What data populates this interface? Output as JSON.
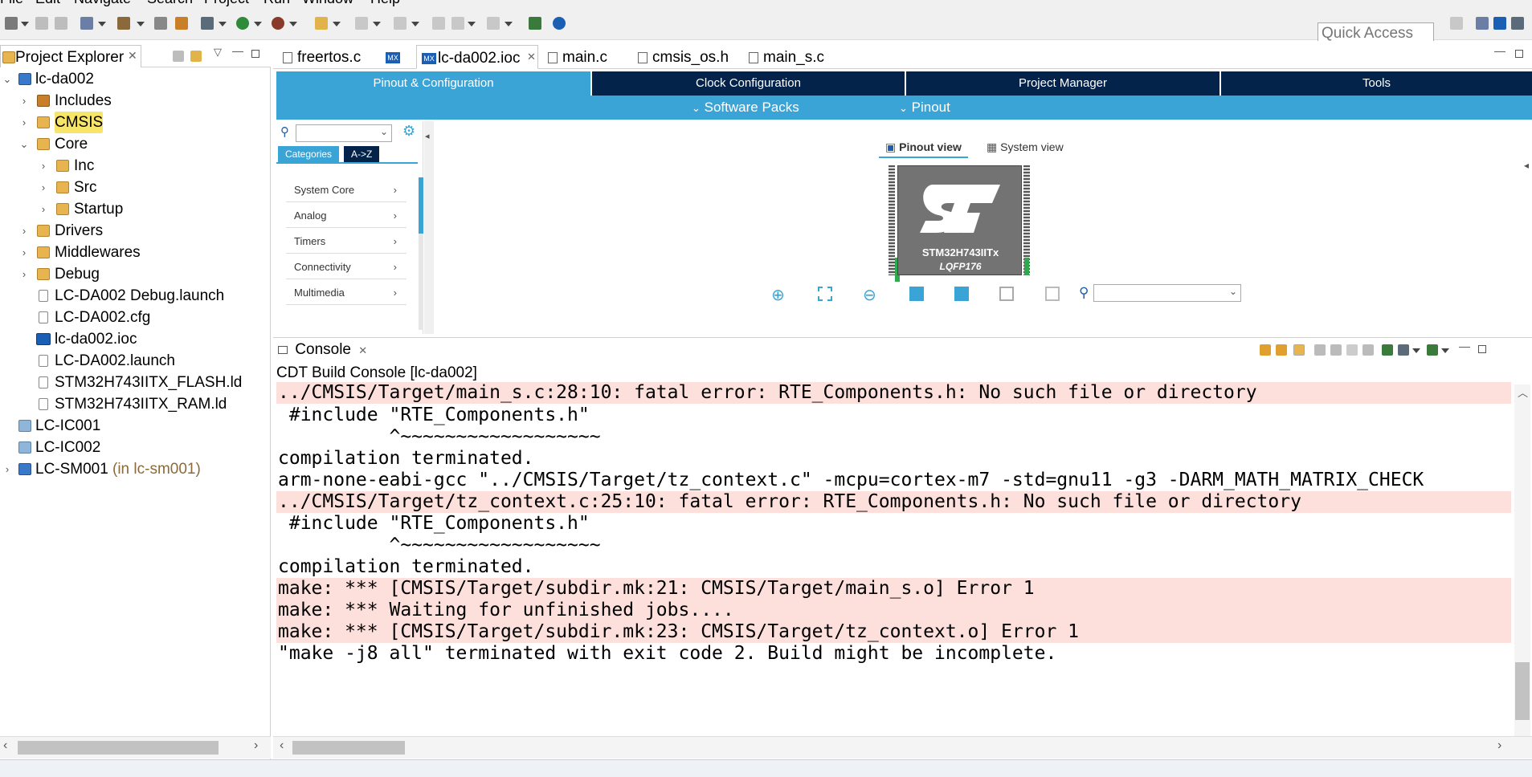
{
  "menu": [
    "File",
    "Edit",
    "Navigate",
    "Search",
    "Project",
    "Run",
    "Window",
    "Help"
  ],
  "toolbar": {
    "quick_access_placeholder": "Quick Access"
  },
  "explorer": {
    "tab_label": "Project Explorer",
    "tree": [
      {
        "label": "lc-da002",
        "arrow": "⌄",
        "icon": "project-icon"
      },
      {
        "label": "Includes",
        "arrow": "›",
        "icon": "includes-icon"
      },
      {
        "label": "CMSIS",
        "arrow": "›",
        "icon": "source-folder-icon"
      },
      {
        "label": "Core",
        "arrow": "⌄",
        "icon": "source-folder-icon"
      },
      {
        "label": "Inc",
        "arrow": "›",
        "icon": "folder-icon"
      },
      {
        "label": "Src",
        "arrow": "›",
        "icon": "folder-icon"
      },
      {
        "label": "Startup",
        "arrow": "›",
        "icon": "folder-icon"
      },
      {
        "label": "Drivers",
        "arrow": "›",
        "icon": "source-folder-icon"
      },
      {
        "label": "Middlewares",
        "arrow": "›",
        "icon": "source-folder-icon"
      },
      {
        "label": "Debug",
        "arrow": "›",
        "icon": "folder-icon"
      },
      {
        "label": "LC-DA002 Debug.launch",
        "arrow": "",
        "icon": "file-icon"
      },
      {
        "label": "LC-DA002.cfg",
        "arrow": "",
        "icon": "file-icon"
      },
      {
        "label": "lc-da002.ioc",
        "arrow": "",
        "icon": "mx-icon"
      },
      {
        "label": "LC-DA002.launch",
        "arrow": "",
        "icon": "file-icon"
      },
      {
        "label": "STM32H743IITX_FLASH.ld",
        "arrow": "",
        "icon": "file-icon"
      },
      {
        "label": "STM32H743IITX_RAM.ld",
        "arrow": "",
        "icon": "file-icon"
      },
      {
        "label": "LC-IC001",
        "arrow": "",
        "icon": "closed-project-icon"
      },
      {
        "label": "LC-IC002",
        "arrow": "",
        "icon": "closed-project-icon"
      },
      {
        "label": "LC-SM001",
        "arrow": "›",
        "icon": "project-icon",
        "suffix": "(in lc-sm001)"
      }
    ]
  },
  "editor": {
    "tabs": [
      {
        "label": "freertos.c",
        "icon": "c-file-icon"
      },
      {
        "label": "",
        "icon": "mx-icon"
      },
      {
        "label": "lc-da002.ioc",
        "icon": "mx-icon",
        "active": true
      },
      {
        "label": "main.c",
        "icon": "c-file-icon"
      },
      {
        "label": "cmsis_os.h",
        "icon": "h-file-icon"
      },
      {
        "label": "main_s.c",
        "icon": "c-file-icon"
      }
    ],
    "mx_tabs": [
      "Pinout & Configuration",
      "Clock Configuration",
      "Project Manager",
      "Tools"
    ],
    "mx_sub": {
      "software_packs": "Software Packs",
      "pinout": "Pinout"
    },
    "category_tabs": {
      "categories": "Categories",
      "az": "A->Z"
    },
    "categories": [
      "System Core",
      "Analog",
      "Timers",
      "Connectivity",
      "Multimedia"
    ],
    "views": {
      "pinout": "Pinout view",
      "system": "System view"
    },
    "chip": {
      "name": "STM32H743IITx",
      "package": "LQFP176"
    }
  },
  "console": {
    "tab_label": "Console",
    "subtitle": "CDT Build Console [lc-da002]",
    "lines": [
      {
        "text": "../CMSIS/Target/main_s.c:28:10: fatal error: RTE_Components.h: No such file or directory",
        "error": true
      },
      {
        "text": " #include \"RTE_Components.h\"",
        "error": false
      },
      {
        "text": "          ^~~~~~~~~~~~~~~~~~~",
        "error": false
      },
      {
        "text": "compilation terminated.",
        "error": false
      },
      {
        "text": "arm-none-eabi-gcc \"../CMSIS/Target/tz_context.c\" -mcpu=cortex-m7 -std=gnu11 -g3 -DARM_MATH_MATRIX_CHECK",
        "error": false
      },
      {
        "text": "../CMSIS/Target/tz_context.c:25:10: fatal error: RTE_Components.h: No such file or directory",
        "error": true
      },
      {
        "text": " #include \"RTE_Components.h\"",
        "error": false
      },
      {
        "text": "          ^~~~~~~~~~~~~~~~~~~",
        "error": false
      },
      {
        "text": "compilation terminated.",
        "error": false
      },
      {
        "text": "make: *** [CMSIS/Target/subdir.mk:21: CMSIS/Target/main_s.o] Error 1",
        "error": true
      },
      {
        "text": "make: *** Waiting for unfinished jobs....",
        "error": true
      },
      {
        "text": "make: *** [CMSIS/Target/subdir.mk:23: CMSIS/Target/tz_context.o] Error 1",
        "error": true
      },
      {
        "text": "\"make -j8 all\" terminated with exit code 2. Build might be incomplete.",
        "error": false
      }
    ]
  },
  "colors": {
    "mx_active_tab": "#3ba4d6",
    "mx_dark_tab": "#03234b",
    "error_line_bg": "#fde0dc",
    "highlight": "#f7e56a"
  }
}
